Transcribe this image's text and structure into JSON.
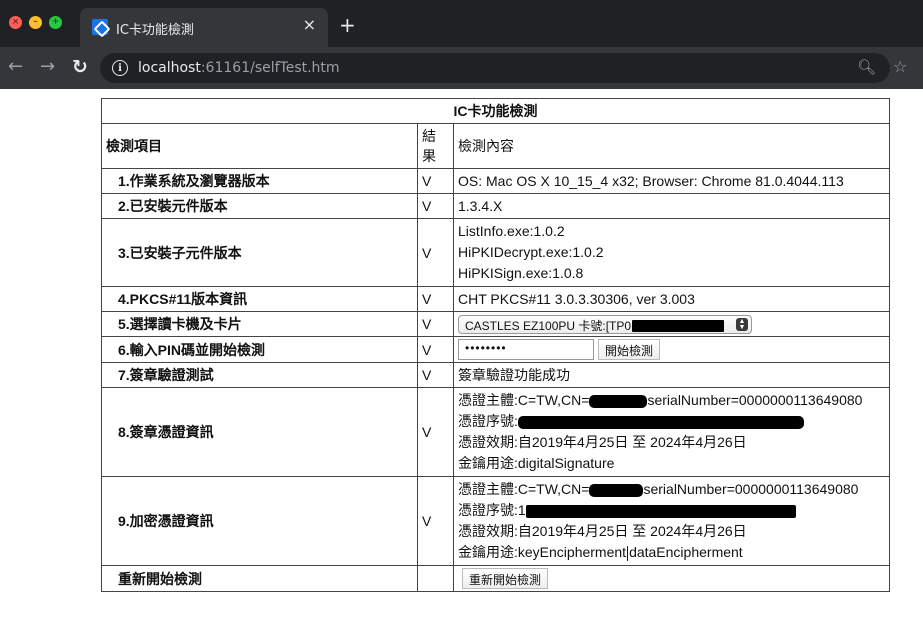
{
  "window": {
    "tab_title": "IC卡功能檢測",
    "tab_close": "×",
    "new_tab": "+"
  },
  "toolbar": {
    "url_host": "localhost",
    "url_rest": ":61161/selfTest.htm",
    "info_glyph": "i"
  },
  "table": {
    "caption": "IC卡功能檢測",
    "headers": {
      "item": "檢測項目",
      "result": "結果",
      "detail": "檢測內容"
    },
    "rows": [
      {
        "item": "1.作業系統及瀏覽器版本",
        "result": "V",
        "detail": "OS: Mac OS X 10_15_4 x32;  Browser: Chrome 81.0.4044.113"
      },
      {
        "item": "2.已安裝元件版本",
        "result": "V",
        "detail": "1.3.4.X"
      },
      {
        "item": "3.已安裝子元件版本",
        "result": "V",
        "lines": [
          "ListInfo.exe:1.0.2",
          "HiPKIDecrypt.exe:1.0.2",
          "HiPKISign.exe:1.0.8"
        ]
      },
      {
        "item": "4.PKCS#11版本資訊",
        "result": "V",
        "detail": "CHT PKCS#11 3.0.3.30306, ver 3.003"
      },
      {
        "item": "5.選擇讀卡機及卡片",
        "result": "V",
        "select_value": "CASTLES EZ100PU 卡號:[TP0"
      },
      {
        "item": "6.輸入PIN碼並開始檢測",
        "result": "V",
        "pin_value": "••••••••",
        "button": "開始檢測"
      },
      {
        "item": "7.簽章驗證測試",
        "result": "V",
        "detail": "簽章驗證功能成功"
      },
      {
        "item": "8.簽章憑證資訊",
        "result": "V",
        "subject_prefix": "憑證主體:C=TW,CN=",
        "subject_suffix": "serialNumber=0000000113649080",
        "serial_label": "憑證序號:",
        "validity": "憑證效期:自2019年4月25日 至 2024年4月26日",
        "usage": "金鑰用途:digitalSignature"
      },
      {
        "item": "9.加密憑證資訊",
        "result": "V",
        "subject_prefix": "憑證主體:C=TW,CN=",
        "subject_suffix": "serialNumber=0000000113649080",
        "serial_label": "憑證序號:1",
        "validity": "憑證效期:自2019年4月25日 至 2024年4月26日",
        "usage_prefix": "金鑰用途:keyEncipherment",
        "usage_suffix": "dataEncipherment"
      },
      {
        "item": "重新開始檢測",
        "result": "",
        "button": "重新開始檢測"
      }
    ]
  }
}
